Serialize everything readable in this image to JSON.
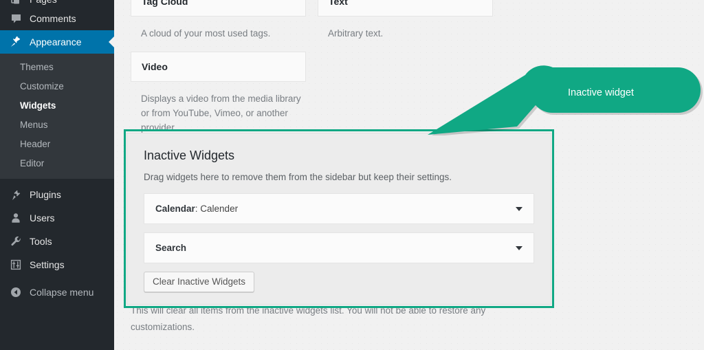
{
  "colors": {
    "sidebar_bg": "#23282d",
    "submenu_bg": "#32373c",
    "active_blue": "#0073aa",
    "highlight_green": "#10a884",
    "page_bg": "#f1f1f1"
  },
  "sidebar": {
    "items": [
      {
        "label": "Pages",
        "icon": "pages-icon",
        "state": "partial"
      },
      {
        "label": "Comments",
        "icon": "comments-icon",
        "state": "normal"
      },
      {
        "label": "Appearance",
        "icon": "appearance-icon",
        "state": "active"
      }
    ],
    "submenu": [
      {
        "label": "Themes",
        "current": false
      },
      {
        "label": "Customize",
        "current": false
      },
      {
        "label": "Widgets",
        "current": true
      },
      {
        "label": "Menus",
        "current": false
      },
      {
        "label": "Header",
        "current": false
      },
      {
        "label": "Editor",
        "current": false
      }
    ],
    "items_lower": [
      {
        "label": "Plugins",
        "icon": "plugin-icon"
      },
      {
        "label": "Users",
        "icon": "user-icon"
      },
      {
        "label": "Tools",
        "icon": "wrench-icon"
      },
      {
        "label": "Settings",
        "icon": "settings-sliders-icon"
      }
    ],
    "collapse": {
      "label": "Collapse menu",
      "icon": "collapse-arrow-icon"
    }
  },
  "available_widgets": {
    "left_column": [
      {
        "title": "Tag Cloud",
        "description": "A cloud of your most used tags."
      },
      {
        "title": "Video",
        "description": "Displays a video from the media library or from YouTube, Vimeo, or another provider."
      }
    ],
    "right_column": [
      {
        "title": "Text",
        "description": "Arbitrary text."
      }
    ]
  },
  "inactive_widgets": {
    "title": "Inactive Widgets",
    "subtitle": "Drag widgets here to remove them from the sidebar but keep their settings.",
    "rows": [
      {
        "title": "Calendar",
        "suffix": ": Calender",
        "caret": "chevron-down-icon"
      },
      {
        "title": "Search",
        "suffix": "",
        "caret": "chevron-down-icon"
      }
    ],
    "clear_button": "Clear Inactive Widgets",
    "clear_help": "This will clear all items from the inactive widgets list. You will not be able to restore any customizations."
  },
  "callout": {
    "label": "Inactive widget",
    "color": "#10a884"
  }
}
